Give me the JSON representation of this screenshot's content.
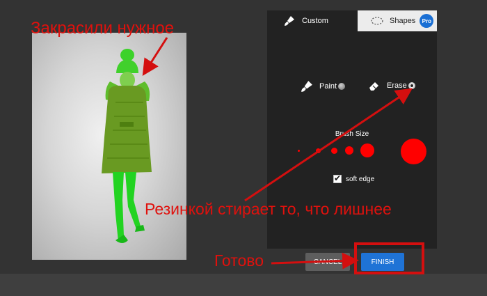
{
  "panel": {
    "tabs": [
      {
        "label": "Custom",
        "icon": "paintbrush-icon"
      },
      {
        "label": "Shapes",
        "icon": "dashed-lasso-icon",
        "badge": "Pro"
      }
    ],
    "tools": {
      "paint_label": "Paint",
      "erase_label": "Erase",
      "selected": "erase"
    },
    "brush_size": {
      "title": "Brush Size",
      "sizes": [
        "xs",
        "s",
        "m",
        "l",
        "xl",
        "xxl"
      ],
      "selected": "none"
    },
    "soft_edge": {
      "label": "soft edge",
      "checked": true
    }
  },
  "buttons": {
    "cancel_label": "CANCEL",
    "finish_label": "FINISH"
  },
  "annotations": {
    "painted": "Закрасили нужное",
    "eraser": "Резинкой стирает то, что лишнее",
    "done": "Готово"
  },
  "colors": {
    "mask_green": "#33dd22",
    "annotation_red": "#e0110d",
    "accent_blue": "#1f73d6",
    "brush_dot_red": "#ff0000"
  }
}
